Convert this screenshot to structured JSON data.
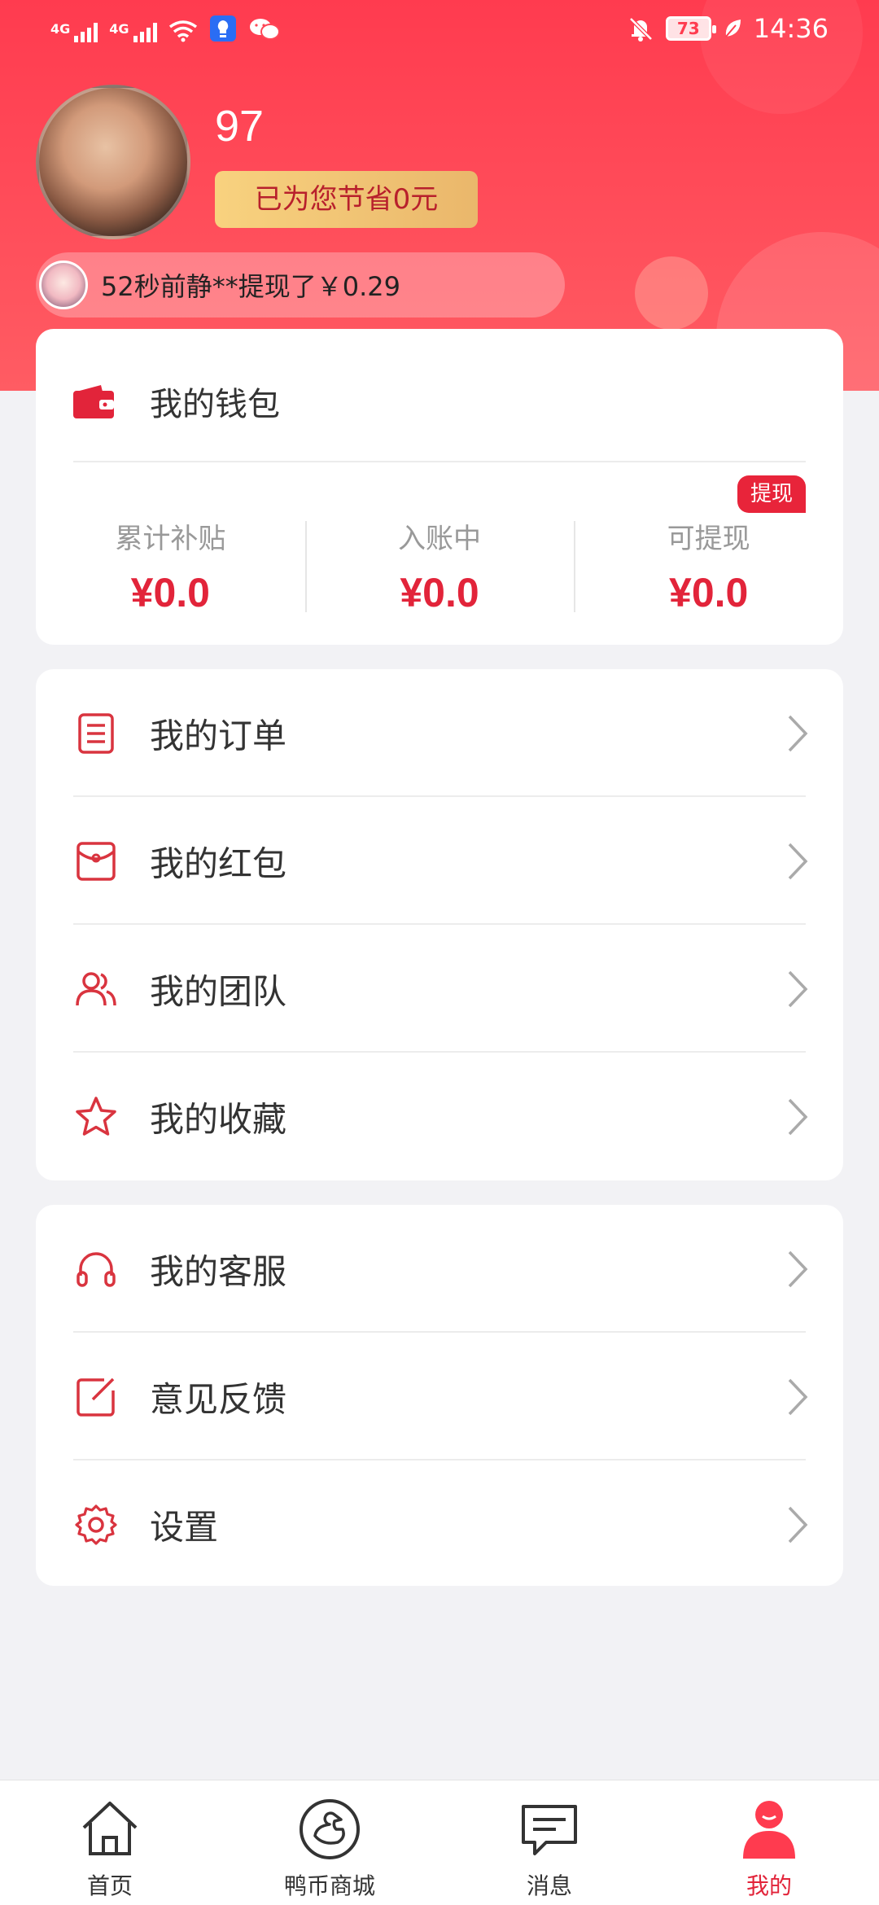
{
  "status_bar": {
    "network_1": "4G",
    "network_2": "4G",
    "battery": "73",
    "time": "14:36"
  },
  "profile": {
    "username": "97",
    "saving_text": "已为您节省0元"
  },
  "ticker": {
    "text": "52秒前静**提现了￥0.29"
  },
  "wallet": {
    "title": "我的钱包",
    "withdraw_tag": "提现",
    "stats": [
      {
        "label": "累计补贴",
        "value": "¥0.0"
      },
      {
        "label": "入账中",
        "value": "¥0.0"
      },
      {
        "label": "可提现",
        "value": "¥0.0"
      }
    ]
  },
  "menu_group_1": [
    {
      "label": "我的订单",
      "icon": "order-list-icon"
    },
    {
      "label": "我的红包",
      "icon": "red-packet-icon"
    },
    {
      "label": "我的团队",
      "icon": "team-icon"
    },
    {
      "label": "我的收藏",
      "icon": "star-icon"
    }
  ],
  "menu_group_2": [
    {
      "label": "我的客服",
      "icon": "headphones-icon"
    },
    {
      "label": "意见反馈",
      "icon": "feedback-edit-icon"
    },
    {
      "label": "设置",
      "icon": "gear-icon"
    }
  ],
  "bottom_nav": [
    {
      "label": "首页",
      "icon": "home-icon"
    },
    {
      "label": "鸭币商城",
      "icon": "duck-mall-icon"
    },
    {
      "label": "消息",
      "icon": "message-icon"
    },
    {
      "label": "我的",
      "icon": "profile-icon",
      "active": true
    }
  ],
  "colors": {
    "brand_red": "#e2243a",
    "header_red": "#ff3b4f",
    "gold": "#eab76b"
  }
}
